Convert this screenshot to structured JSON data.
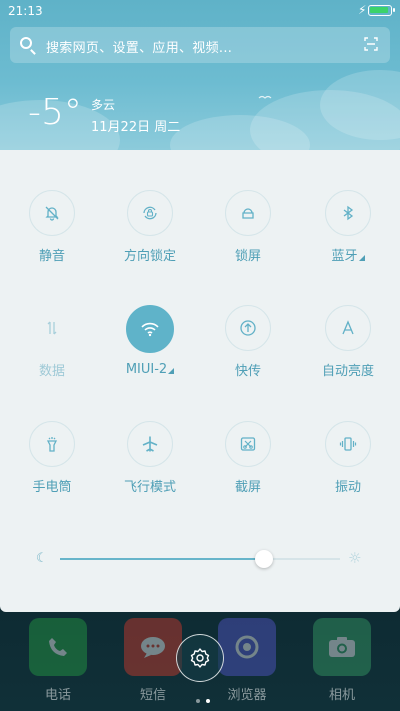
{
  "status_bar": {
    "time": "21:13"
  },
  "search": {
    "placeholder": "搜索网页、设置、应用、视频..."
  },
  "weather": {
    "temperature": "-5°",
    "condition": "多云",
    "date": "11月22日 周二"
  },
  "toggles": [
    {
      "label": "静音",
      "icon": "bell-off-icon",
      "active": false
    },
    {
      "label": "方向锁定",
      "icon": "rotation-lock-icon",
      "active": false
    },
    {
      "label": "锁屏",
      "icon": "lock-icon",
      "active": false
    },
    {
      "label": "蓝牙",
      "icon": "bluetooth-icon",
      "active": false
    },
    {
      "label": "数据",
      "icon": "data-arrows-icon",
      "active": false
    },
    {
      "label": "MIUI-2",
      "icon": "wifi-icon",
      "active": true
    },
    {
      "label": "快传",
      "icon": "share-upload-icon",
      "active": false
    },
    {
      "label": "自动亮度",
      "icon": "auto-brightness-icon",
      "active": false
    },
    {
      "label": "手电筒",
      "icon": "flashlight-icon",
      "active": false
    },
    {
      "label": "飞行模式",
      "icon": "airplane-icon",
      "active": false
    },
    {
      "label": "截屏",
      "icon": "screenshot-icon",
      "active": false
    },
    {
      "label": "振动",
      "icon": "vibrate-icon",
      "active": false
    }
  ],
  "brightness": {
    "level": 0.73
  },
  "dock": [
    {
      "name": "电话",
      "icon": "phone-icon",
      "color": "#27a845"
    },
    {
      "name": "短信",
      "icon": "message-icon",
      "color": "#e23a2a"
    },
    {
      "name": "浏览器",
      "icon": "browser-icon",
      "color": "#5a5ad8"
    },
    {
      "name": "相机",
      "icon": "camera-icon",
      "color": "#3aa86a"
    }
  ],
  "colors": {
    "accent": "#5fb3c9",
    "panel": "#edf2f3"
  }
}
